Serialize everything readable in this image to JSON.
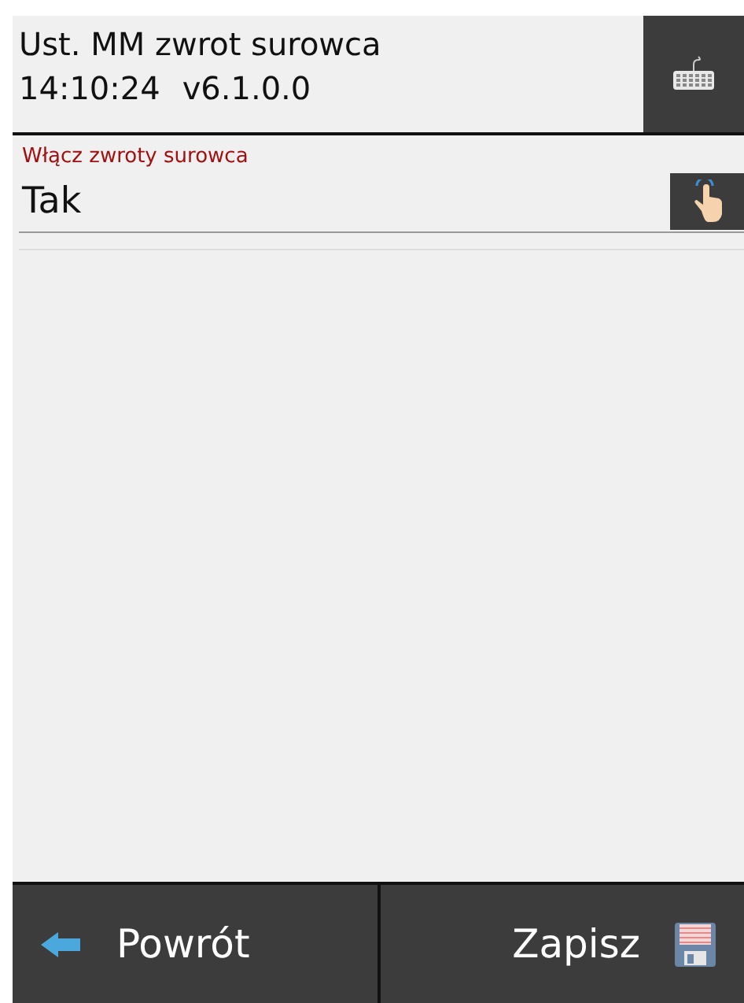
{
  "header": {
    "title": "Ust. MM zwrot surowca",
    "time": "14:10:24",
    "version": "v6.1.0.0"
  },
  "field": {
    "label": "Włącz zwroty surowca",
    "value": "Tak"
  },
  "footer": {
    "buttons": [
      {
        "kind": "back",
        "label": "Powrót"
      },
      {
        "kind": "save",
        "label": "Zapisz"
      }
    ]
  }
}
